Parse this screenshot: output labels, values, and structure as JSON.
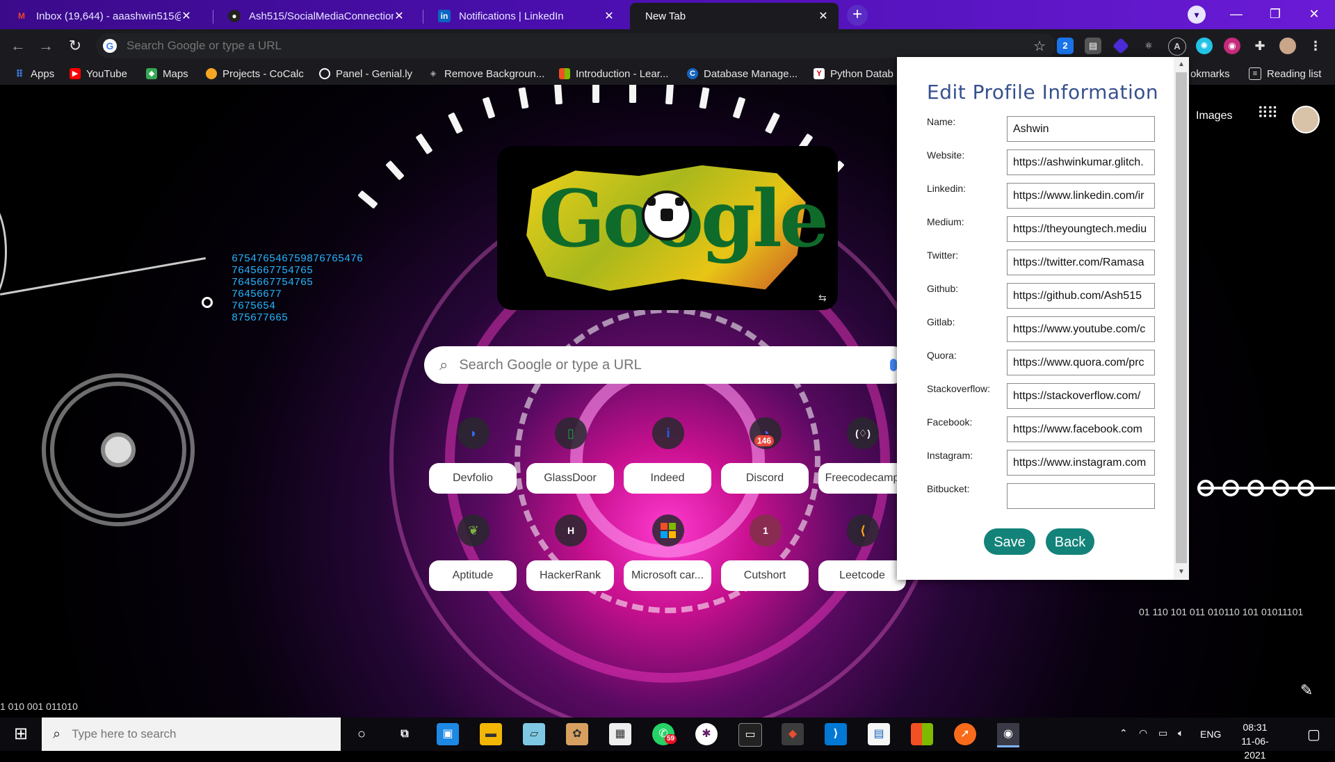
{
  "tabs": [
    {
      "title": "Inbox (19,644) - aaashwin515@g",
      "icon": "gmail-icon",
      "color": "#ea4335"
    },
    {
      "title": "Ash515/SocialMediaConnection:",
      "icon": "github-icon",
      "color": "#333333"
    },
    {
      "title": "Notifications | LinkedIn",
      "icon": "linkedin-icon",
      "color": "#0a66c2"
    },
    {
      "title": "New Tab",
      "icon": "none",
      "color": "#1b1b1f"
    }
  ],
  "toolbar": {
    "omnibox_placeholder": "Search Google or type a URL",
    "extension_badge": "2"
  },
  "bookmarks": [
    {
      "label": "Apps",
      "icon": "apps-grid-icon",
      "color": "#4285f4"
    },
    {
      "label": "YouTube",
      "icon": "youtube-icon",
      "color": "#ff0000"
    },
    {
      "label": "Maps",
      "icon": "maps-icon",
      "color": "#34a853"
    },
    {
      "label": "Projects - CoCalc",
      "icon": "cocalc-icon",
      "color": "#f5a623"
    },
    {
      "label": "Panel - Genial.ly",
      "icon": "genially-icon",
      "color": "#ffffff"
    },
    {
      "label": "Remove Backgroun...",
      "icon": "removebg-icon",
      "color": "#888888"
    },
    {
      "label": "Introduction - Lear...",
      "icon": "microsoft-learn-icon",
      "color": "#f25022"
    },
    {
      "label": "Database Manage...",
      "icon": "database-icon",
      "color": "#1565c0"
    },
    {
      "label": "Python Datab",
      "icon": "python-icon",
      "color": "#ffffff"
    }
  ],
  "bookmarks_right": {
    "other": "okmarks",
    "reading_list": "Reading list"
  },
  "newtab": {
    "search_placeholder": "Search Google or type a URL",
    "images_link": "Images",
    "doodle_word": "Google",
    "number_lines": [
      "675476546759876765476",
      "7645667754765",
      "7645667754765",
      "76456677",
      "7675654",
      "875677665"
    ],
    "binary_right": "01  110  101  011  010110  101  01011101",
    "binary_left": "1  010  001  011010",
    "shortcuts": [
      {
        "label": "Devfolio",
        "icon": "devfolio-icon",
        "color": "#3770ff"
      },
      {
        "label": "GlassDoor",
        "icon": "glassdoor-icon",
        "color": "#0caa41"
      },
      {
        "label": "Indeed",
        "icon": "indeed-icon",
        "color": "#2164f3"
      },
      {
        "label": "Discord",
        "icon": "discord-icon",
        "color": "#5865f2",
        "badge": "146"
      },
      {
        "label": "Freecodecamp",
        "icon": "freecodecamp-icon",
        "color": "#0a0a23"
      },
      {
        "label": "Aptitude",
        "icon": "aptitude-icon",
        "color": "#5a8f2a"
      },
      {
        "label": "HackerRank",
        "icon": "hackerrank-icon",
        "color": "#1ba94c"
      },
      {
        "label": "Microsoft car...",
        "icon": "microsoft-icon",
        "color": "#f25022"
      },
      {
        "label": "Cutshort",
        "icon": "cutshort-icon",
        "color": "#b03060",
        "badge": "1"
      },
      {
        "label": "Leetcode",
        "icon": "leetcode-icon",
        "color": "#ffa116"
      }
    ]
  },
  "popup": {
    "title": "Edit Profile Information",
    "fields": [
      {
        "label": "Name:",
        "value": "Ashwin"
      },
      {
        "label": "Website:",
        "value": "https://ashwinkumar.glitch."
      },
      {
        "label": "Linkedin:",
        "value": "https://www.linkedin.com/ir"
      },
      {
        "label": "Medium:",
        "value": "https://theyoungtech.mediu"
      },
      {
        "label": "Twitter:",
        "value": "https://twitter.com/Ramasa"
      },
      {
        "label": "Github:",
        "value": "https://github.com/Ash515"
      },
      {
        "label": "Gitlab:",
        "value": "https://www.youtube.com/c"
      },
      {
        "label": "Quora:",
        "value": "https://www.quora.com/prc"
      },
      {
        "label": "Stackoverflow:",
        "value": "https://stackoverflow.com/"
      },
      {
        "label": "Facebook:",
        "value": "https://www.facebook.com"
      },
      {
        "label": "Instagram:",
        "value": "https://www.instagram.com"
      },
      {
        "label": "Bitbucket:",
        "value": ""
      }
    ],
    "save_label": "Save",
    "back_label": "Back",
    "accent": "#13837a"
  },
  "taskbar": {
    "search_placeholder": "Type here to search",
    "whatsapp_badge": "59",
    "language": "ENG",
    "time": "08:31",
    "date": "11-06-2021"
  }
}
